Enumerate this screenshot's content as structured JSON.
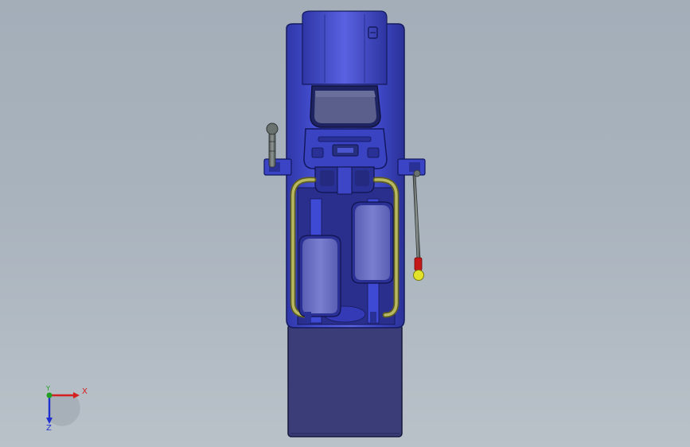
{
  "colors": {
    "background_top": "#a3aeb9",
    "background_bottom": "#b9c1c9",
    "body_blue": "#3f49c9",
    "body_dark": "#2b329a",
    "deck_navy": "#3b3d78",
    "pedal_lavender": "#6e73c4",
    "handrail_olive": "#9a9a52",
    "lever_grey": "#6a7270",
    "knob_red": "#c41818",
    "knob_yellow": "#e2e22a",
    "axis_x": "#d42020",
    "axis_y": "#20a020",
    "axis_z": "#2030d0"
  },
  "triad": {
    "x_label": "X",
    "y_label": "Y",
    "z_label": "Z"
  },
  "view": {
    "orientation": "top"
  }
}
